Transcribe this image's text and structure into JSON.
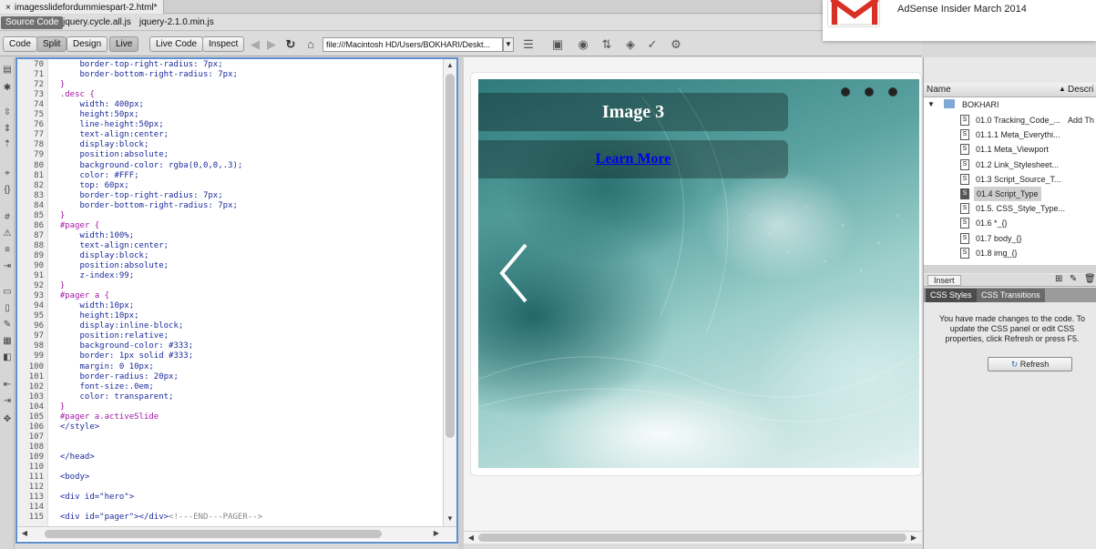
{
  "document_tab": {
    "title": "imagesslidefordummiespart-2.html*",
    "close": "×"
  },
  "related_files": {
    "source": "Source Code",
    "files": [
      "jquery.cycle.all.js",
      "jquery-2.1.0.min.js"
    ]
  },
  "toolbar": {
    "code": "Code",
    "split": "Split",
    "design": "Design",
    "live": "Live",
    "live_code": "Live Code",
    "inspect": "Inspect",
    "address": "file:///Macintosh HD/Users/BOKHARI/Deskt..."
  },
  "code": {
    "lines": [
      {
        "n": "70",
        "parts": [
          [
            "p",
            "      border-top-right-radius: 7px;"
          ]
        ]
      },
      {
        "n": "71",
        "parts": [
          [
            "p",
            "      border-bottom-right-radius: 7px;"
          ]
        ]
      },
      {
        "n": "72",
        "parts": [
          [
            "s",
            "  }"
          ]
        ]
      },
      {
        "n": "73",
        "parts": [
          [
            "s",
            "  .desc {"
          ]
        ]
      },
      {
        "n": "74",
        "parts": [
          [
            "p",
            "      width: 400px;"
          ]
        ]
      },
      {
        "n": "75",
        "parts": [
          [
            "p",
            "      height:50px;"
          ]
        ]
      },
      {
        "n": "76",
        "parts": [
          [
            "p",
            "      line-height:50px;"
          ]
        ]
      },
      {
        "n": "77",
        "parts": [
          [
            "p",
            "      text-align:center;"
          ]
        ]
      },
      {
        "n": "78",
        "parts": [
          [
            "p",
            "      display:block;"
          ]
        ]
      },
      {
        "n": "79",
        "parts": [
          [
            "p",
            "      position:absolute;"
          ]
        ]
      },
      {
        "n": "80",
        "parts": [
          [
            "p",
            "      background-color: rgba(0,0,0,.3);"
          ]
        ]
      },
      {
        "n": "81",
        "parts": [
          [
            "p",
            "      color: #FFF;"
          ]
        ]
      },
      {
        "n": "82",
        "parts": [
          [
            "p",
            "      top: 60px;"
          ]
        ]
      },
      {
        "n": "83",
        "parts": [
          [
            "p",
            "      border-top-right-radius: 7px;"
          ]
        ]
      },
      {
        "n": "84",
        "parts": [
          [
            "p",
            "      border-bottom-right-radius: 7px;"
          ]
        ]
      },
      {
        "n": "85",
        "parts": [
          [
            "s",
            "  }"
          ]
        ]
      },
      {
        "n": "86",
        "parts": [
          [
            "s",
            "  #pager {"
          ]
        ]
      },
      {
        "n": "87",
        "parts": [
          [
            "p",
            "      width:100%;"
          ]
        ]
      },
      {
        "n": "88",
        "parts": [
          [
            "p",
            "      text-align:center;"
          ]
        ]
      },
      {
        "n": "89",
        "parts": [
          [
            "p",
            "      display:block;"
          ]
        ]
      },
      {
        "n": "90",
        "parts": [
          [
            "p",
            "      position:absolute;"
          ]
        ]
      },
      {
        "n": "91",
        "parts": [
          [
            "p",
            "      z-index:99;"
          ]
        ]
      },
      {
        "n": "92",
        "parts": [
          [
            "s",
            "  }"
          ]
        ]
      },
      {
        "n": "93",
        "parts": [
          [
            "s",
            "  #pager a {"
          ]
        ]
      },
      {
        "n": "94",
        "parts": [
          [
            "p",
            "      width:10px;"
          ]
        ]
      },
      {
        "n": "95",
        "parts": [
          [
            "p",
            "      height:10px;"
          ]
        ]
      },
      {
        "n": "96",
        "parts": [
          [
            "p",
            "      display:inline-block;"
          ]
        ]
      },
      {
        "n": "97",
        "parts": [
          [
            "p",
            "      position:relative;"
          ]
        ]
      },
      {
        "n": "98",
        "parts": [
          [
            "p",
            "      background-color: #333;"
          ]
        ]
      },
      {
        "n": "99",
        "parts": [
          [
            "p",
            "      border: 1px solid #333;"
          ]
        ]
      },
      {
        "n": "100",
        "parts": [
          [
            "p",
            "      margin: 0 10px;"
          ]
        ]
      },
      {
        "n": "101",
        "parts": [
          [
            "p",
            "      border-radius: 20px;"
          ]
        ]
      },
      {
        "n": "102",
        "parts": [
          [
            "p",
            "      font-size:.0em;"
          ]
        ]
      },
      {
        "n": "103",
        "parts": [
          [
            "p",
            "      color: transparent;"
          ]
        ]
      },
      {
        "n": "104",
        "parts": [
          [
            "s",
            "  }"
          ]
        ]
      },
      {
        "n": "105",
        "parts": [
          [
            "s",
            "  #pager a.activeSlide"
          ]
        ]
      },
      {
        "n": "106",
        "parts": [
          [
            "t",
            "  </style>"
          ]
        ]
      },
      {
        "n": "107",
        "parts": []
      },
      {
        "n": "108",
        "parts": []
      },
      {
        "n": "109",
        "parts": [
          [
            "t",
            "  </head>"
          ]
        ]
      },
      {
        "n": "110",
        "parts": []
      },
      {
        "n": "111",
        "parts": [
          [
            "t",
            "  <body>"
          ]
        ]
      },
      {
        "n": "112",
        "parts": []
      },
      {
        "n": "113",
        "parts": [
          [
            "t",
            "  <div id=\"hero\">"
          ]
        ]
      },
      {
        "n": "114",
        "parts": []
      },
      {
        "n": "115",
        "parts": [
          [
            "t",
            "  <div id=\"pager\"></div>"
          ],
          [
            "c",
            "<!---END---PAGER-->"
          ]
        ]
      }
    ]
  },
  "live": {
    "slide_title": "Image 3",
    "link_text": "Learn More",
    "pager_count": 3
  },
  "files_panel": {
    "col_name": "Name",
    "col_desc": "Descri",
    "root": "BOKHARI",
    "extra": "Add Th",
    "items": [
      "01.0 Tracking_Code_...",
      "01.1.1 Meta_Everythi...",
      "01.1 Meta_Viewport",
      "01.2 Link_Stylesheet...",
      "01.3 Script_Source_T...",
      "01.4 Script_Type",
      "01.5. CSS_Style_Type...",
      "01.6 *_{}",
      "01.7 body_{}",
      "01.8 img_{}"
    ],
    "selected_index": 5
  },
  "insert": {
    "label": "Insert"
  },
  "css_panel": {
    "tab_styles": "CSS Styles",
    "tab_transitions": "CSS Transitions",
    "message": "You have made changes to the code. To update the CSS panel or edit CSS properties, click Refresh or press F5.",
    "refresh": "Refresh"
  },
  "notification": {
    "text": "AdSense Insider March 2014"
  },
  "colors": {
    "accent": "#5d8fd1",
    "selector": "#a316a3",
    "property": "#1b2a9c"
  }
}
